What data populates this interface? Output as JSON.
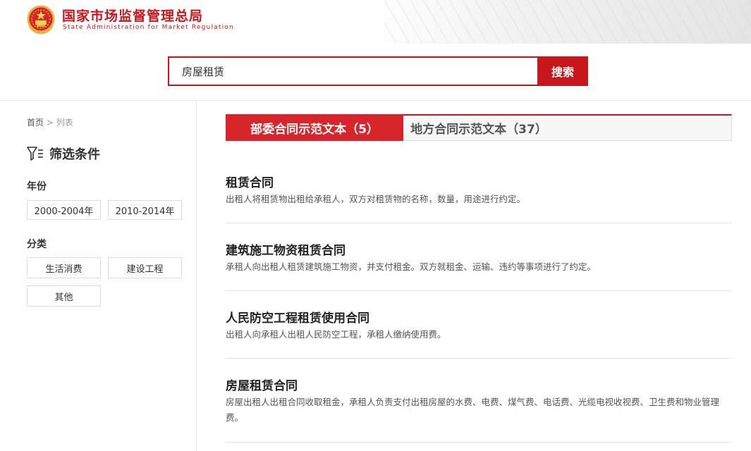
{
  "header": {
    "org_name_cn": "国家市场监督管理总局",
    "org_name_en": "State Administration for Market Regulation"
  },
  "search": {
    "value": "房屋租赁",
    "button_label": "搜索"
  },
  "breadcrumb": {
    "home": "首页",
    "separator": ">",
    "current": "列表"
  },
  "filters": {
    "title": "筛选条件",
    "year_label": "年份",
    "years": [
      "2000-2004年",
      "2010-2014年"
    ],
    "category_label": "分类",
    "categories": [
      "生活消费",
      "建设工程",
      "其他"
    ]
  },
  "tabs": [
    {
      "label": "部委合同示范文本（5）",
      "active": true
    },
    {
      "label": "地方合同示范文本（37）",
      "active": false
    }
  ],
  "results": [
    {
      "title": "租赁合同",
      "desc": "出租人将租赁物出租给承租人，双方对租赁物的名称，数量，用途进行约定。"
    },
    {
      "title": "建筑施工物资租赁合同",
      "desc": "承租人向出租人租赁建筑施工物资，并支付租金。双方就租金、运输、违约等事项进行了约定。"
    },
    {
      "title": "人民防空工程租赁使用合同",
      "desc": "出租人向承租人出租人民防空工程，承租人缴纳使用费。"
    },
    {
      "title": "房屋租赁合同",
      "desc": "房屋出租人出租合同收取租金，承租人负责支付出租房屋的水费、电费、煤气费、电话费、光缆电视收视费、卫生费和物业管理费。"
    }
  ],
  "colors": {
    "brand_red": "#c8161d",
    "tab_active_bg": "#d7262b"
  },
  "icons": {
    "emblem": "national-emblem-icon",
    "filter": "filter-icon"
  }
}
